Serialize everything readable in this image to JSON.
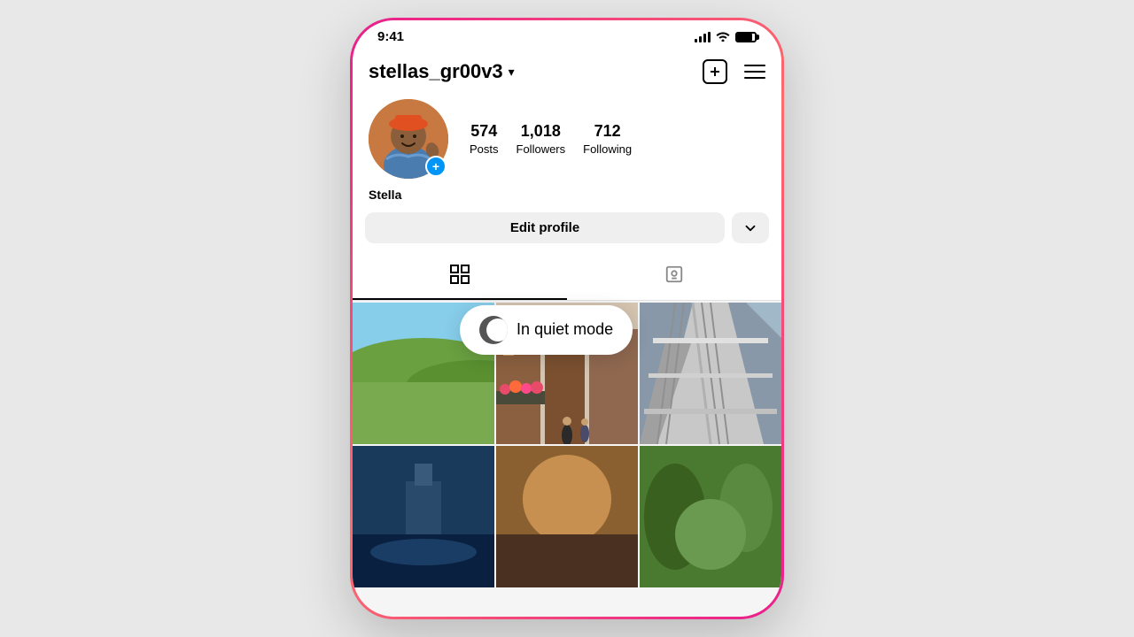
{
  "phone": {
    "status_time": "9:41",
    "username": "stellas_gr00v3",
    "profile_name": "Stella",
    "stats": {
      "posts": {
        "count": "574",
        "label": "Posts"
      },
      "followers": {
        "count": "1,018",
        "label": "Followers"
      },
      "following": {
        "count": "712",
        "label": "Following"
      }
    },
    "quiet_mode_text": "In quiet mode",
    "edit_profile_label": "Edit profile",
    "chevron_label": "▾",
    "add_icon_label": "＋",
    "hamburger_label": "☰"
  }
}
